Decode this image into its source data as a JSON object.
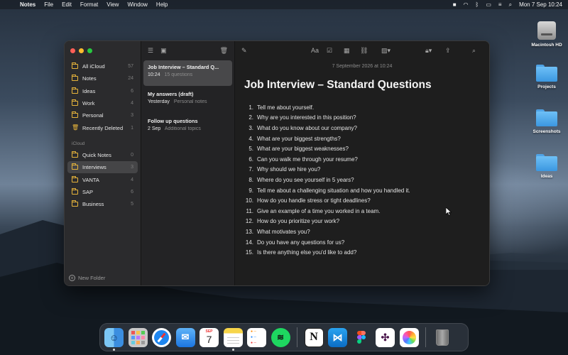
{
  "menubar": {
    "app_name": "Notes",
    "items": [
      "File",
      "Edit",
      "Format",
      "View",
      "Window",
      "Help"
    ],
    "datetime": "Mon 7 Sep  10:24"
  },
  "desktop": {
    "icons": [
      "Macintosh HD",
      "Projects",
      "Screenshots",
      "Ideas"
    ]
  },
  "sidebar": {
    "folders": [
      {
        "label": "All iCloud",
        "count": "57"
      },
      {
        "label": "Notes",
        "count": "24"
      },
      {
        "label": "Ideas",
        "count": "6"
      },
      {
        "label": "Work",
        "count": "4"
      },
      {
        "label": "Personal",
        "count": "3"
      },
      {
        "label": "Recently Deleted",
        "count": "1"
      }
    ],
    "section_label": "iCloud",
    "icloud_folders": [
      {
        "label": "Quick Notes",
        "count": "0"
      },
      {
        "label": "Interviews",
        "count": "3"
      },
      {
        "label": "VANTA",
        "count": "4"
      },
      {
        "label": "SAP",
        "count": "6"
      },
      {
        "label": "Business",
        "count": "5"
      }
    ],
    "new_folder": "New Folder"
  },
  "notes_list": [
    {
      "title": "Job Interview – Standard Q...",
      "date": "10:24",
      "preview": "15 questions"
    },
    {
      "title": "My answers (draft)",
      "date": "Yesterday",
      "preview": "Personal notes"
    },
    {
      "title": "Follow up questions",
      "date": "2 Sep",
      "preview": "Additional topics"
    }
  ],
  "editor": {
    "date_stamp": "7 September 2026 at 10:24",
    "title": "Job Interview – Standard Questions",
    "format_label": "Aa",
    "questions": [
      "Tell me about yourself.",
      "Why are you interested in this position?",
      "What do you know about our company?",
      "What are your biggest strengths?",
      "What are your biggest weaknesses?",
      "Can you walk me through your resume?",
      "Why should we hire you?",
      "Where do you see yourself in 5 years?",
      "Tell me about a challenging situation and how you handled it.",
      "How do you handle stress or tight deadlines?",
      "Give an example of a time you worked in a team.",
      "How do you prioritize your work?",
      "What motivates you?",
      "Do you have any questions for us?",
      "Is there anything else you'd like to add?"
    ]
  },
  "dock": {
    "calendar_month": "SEP",
    "calendar_day": "7",
    "apps": [
      "finder",
      "launchpad",
      "safari",
      "mail",
      "calendar",
      "notes",
      "reminders",
      "spotify",
      "notion",
      "vscode",
      "figma",
      "slack",
      "photos",
      "trash"
    ]
  },
  "colors": {
    "accent_folder": "#e8b53b",
    "selection": "#48484a",
    "window_bg": "#1e1e1e"
  }
}
